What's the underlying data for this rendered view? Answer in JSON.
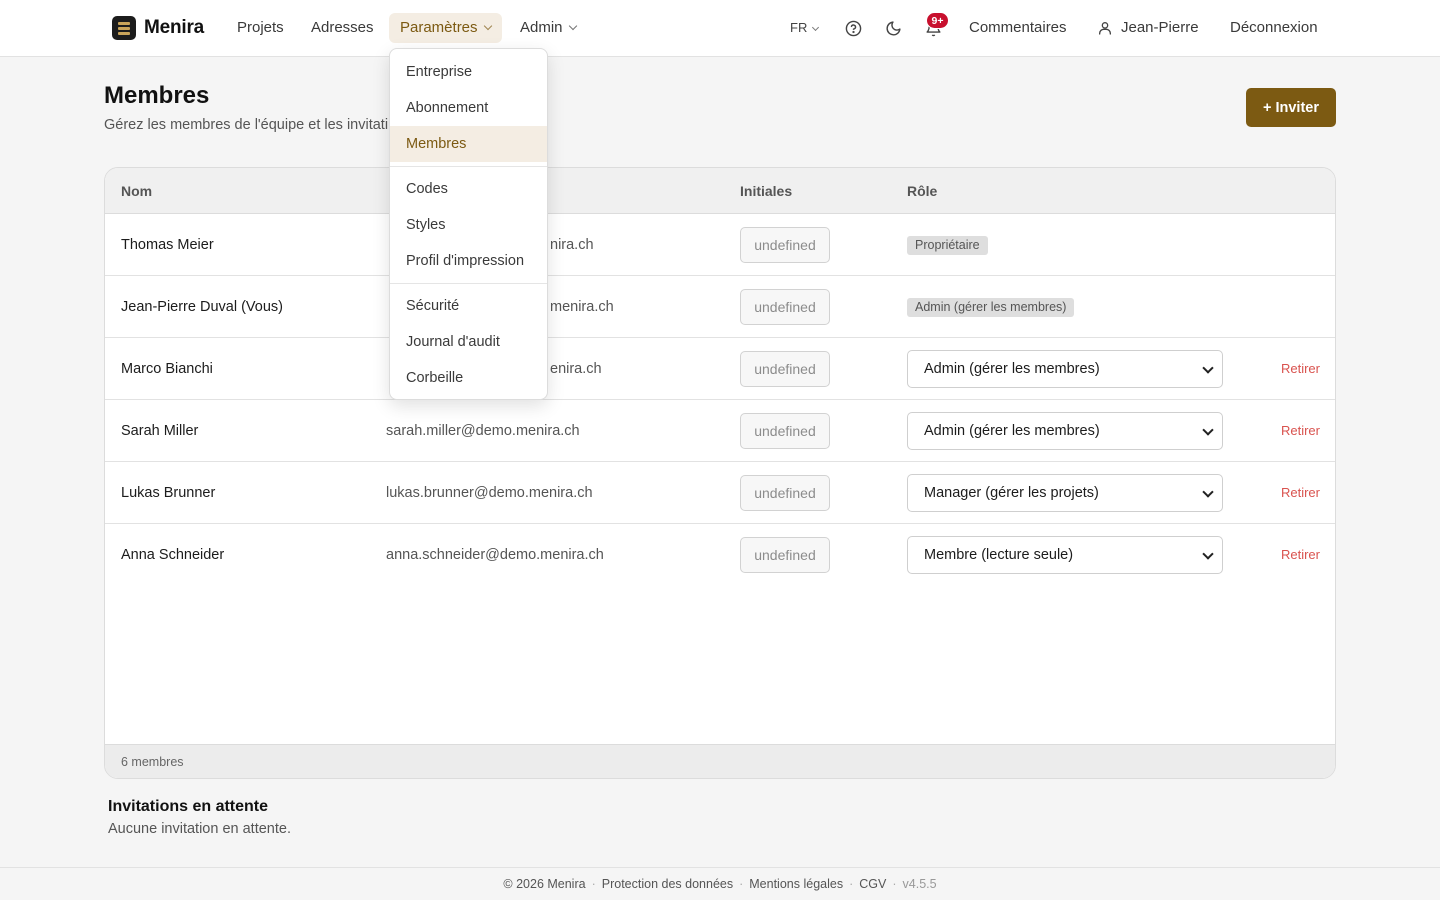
{
  "header": {
    "brand": "Menira",
    "nav": [
      {
        "label": "Projets"
      },
      {
        "label": "Adresses"
      },
      {
        "label": "Paramètres"
      },
      {
        "label": "Admin"
      }
    ],
    "language": "FR",
    "notifications_count": "9+",
    "feedback_label": "Commentaires",
    "user_name": "Jean-Pierre",
    "logout_label": "Déconnexion",
    "accent_color": "#7c5a12"
  },
  "settings_menu": {
    "items": [
      {
        "label": "Entreprise"
      },
      {
        "label": "Abonnement"
      },
      {
        "label": "Membres"
      },
      {
        "label": "Codes"
      },
      {
        "label": "Styles"
      },
      {
        "label": "Profil d'impression"
      },
      {
        "label": "Sécurité"
      },
      {
        "label": "Journal d'audit"
      },
      {
        "label": "Corbeille"
      }
    ],
    "active": "Membres"
  },
  "page": {
    "title": "Membres",
    "subtitle": "Gérez les membres de l'équipe et les invitati",
    "invite_label": "+ Inviter"
  },
  "table": {
    "columns": [
      "Nom",
      "",
      "Initiales",
      "Rôle"
    ],
    "rows": [
      {
        "name": "Thomas Meier",
        "email": "nira.ch",
        "initials": "undefined",
        "role": "Propriétaire",
        "remove": ""
      },
      {
        "name": "Jean-Pierre Duval (Vous)",
        "email": "menira.ch",
        "initials": "undefined",
        "role": "Admin (gérer les membres)",
        "remove": ""
      },
      {
        "name": "Marco Bianchi",
        "email": "enira.ch",
        "initials": "undefined",
        "role": "Admin (gérer les membres)",
        "remove": "Retirer"
      },
      {
        "name": "Sarah Miller",
        "email": "sarah.miller@demo.menira.ch",
        "initials": "undefined",
        "role": "Admin (gérer les membres)",
        "remove": "Retirer"
      },
      {
        "name": "Lukas Brunner",
        "email": "lukas.brunner@demo.menira.ch",
        "initials": "undefined",
        "role": "Manager (gérer les projets)",
        "remove": "Retirer"
      },
      {
        "name": "Anna Schneider",
        "email": "anna.schneider@demo.menira.ch",
        "initials": "undefined",
        "role": "Membre (lecture seule)",
        "remove": "Retirer"
      }
    ],
    "footer": "6 membres"
  },
  "invitations": {
    "title": "Invitations en attente",
    "empty": "Aucune invitation en attente."
  },
  "footer": {
    "copyright": "© 2026 Menira",
    "links": [
      "Protection des données",
      "Mentions légales",
      "CGV"
    ],
    "version": "v4.5.5"
  }
}
